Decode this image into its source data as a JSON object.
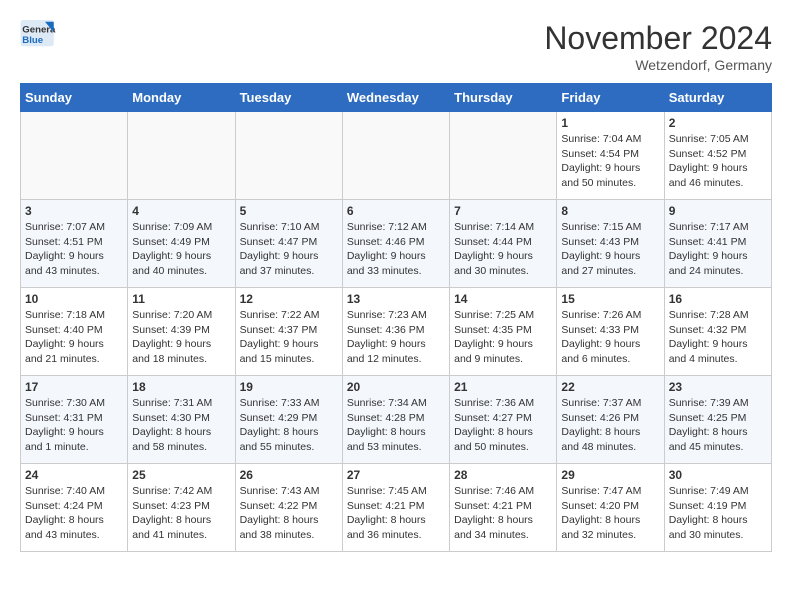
{
  "header": {
    "logo_line1": "General",
    "logo_line2": "Blue",
    "month_title": "November 2024",
    "location": "Wetzendorf, Germany"
  },
  "calendar": {
    "days_of_week": [
      "Sunday",
      "Monday",
      "Tuesday",
      "Wednesday",
      "Thursday",
      "Friday",
      "Saturday"
    ],
    "weeks": [
      [
        {
          "day": "",
          "info": ""
        },
        {
          "day": "",
          "info": ""
        },
        {
          "day": "",
          "info": ""
        },
        {
          "day": "",
          "info": ""
        },
        {
          "day": "",
          "info": ""
        },
        {
          "day": "1",
          "info": "Sunrise: 7:04 AM\nSunset: 4:54 PM\nDaylight: 9 hours\nand 50 minutes."
        },
        {
          "day": "2",
          "info": "Sunrise: 7:05 AM\nSunset: 4:52 PM\nDaylight: 9 hours\nand 46 minutes."
        }
      ],
      [
        {
          "day": "3",
          "info": "Sunrise: 7:07 AM\nSunset: 4:51 PM\nDaylight: 9 hours\nand 43 minutes."
        },
        {
          "day": "4",
          "info": "Sunrise: 7:09 AM\nSunset: 4:49 PM\nDaylight: 9 hours\nand 40 minutes."
        },
        {
          "day": "5",
          "info": "Sunrise: 7:10 AM\nSunset: 4:47 PM\nDaylight: 9 hours\nand 37 minutes."
        },
        {
          "day": "6",
          "info": "Sunrise: 7:12 AM\nSunset: 4:46 PM\nDaylight: 9 hours\nand 33 minutes."
        },
        {
          "day": "7",
          "info": "Sunrise: 7:14 AM\nSunset: 4:44 PM\nDaylight: 9 hours\nand 30 minutes."
        },
        {
          "day": "8",
          "info": "Sunrise: 7:15 AM\nSunset: 4:43 PM\nDaylight: 9 hours\nand 27 minutes."
        },
        {
          "day": "9",
          "info": "Sunrise: 7:17 AM\nSunset: 4:41 PM\nDaylight: 9 hours\nand 24 minutes."
        }
      ],
      [
        {
          "day": "10",
          "info": "Sunrise: 7:18 AM\nSunset: 4:40 PM\nDaylight: 9 hours\nand 21 minutes."
        },
        {
          "day": "11",
          "info": "Sunrise: 7:20 AM\nSunset: 4:39 PM\nDaylight: 9 hours\nand 18 minutes."
        },
        {
          "day": "12",
          "info": "Sunrise: 7:22 AM\nSunset: 4:37 PM\nDaylight: 9 hours\nand 15 minutes."
        },
        {
          "day": "13",
          "info": "Sunrise: 7:23 AM\nSunset: 4:36 PM\nDaylight: 9 hours\nand 12 minutes."
        },
        {
          "day": "14",
          "info": "Sunrise: 7:25 AM\nSunset: 4:35 PM\nDaylight: 9 hours\nand 9 minutes."
        },
        {
          "day": "15",
          "info": "Sunrise: 7:26 AM\nSunset: 4:33 PM\nDaylight: 9 hours\nand 6 minutes."
        },
        {
          "day": "16",
          "info": "Sunrise: 7:28 AM\nSunset: 4:32 PM\nDaylight: 9 hours\nand 4 minutes."
        }
      ],
      [
        {
          "day": "17",
          "info": "Sunrise: 7:30 AM\nSunset: 4:31 PM\nDaylight: 9 hours\nand 1 minute."
        },
        {
          "day": "18",
          "info": "Sunrise: 7:31 AM\nSunset: 4:30 PM\nDaylight: 8 hours\nand 58 minutes."
        },
        {
          "day": "19",
          "info": "Sunrise: 7:33 AM\nSunset: 4:29 PM\nDaylight: 8 hours\nand 55 minutes."
        },
        {
          "day": "20",
          "info": "Sunrise: 7:34 AM\nSunset: 4:28 PM\nDaylight: 8 hours\nand 53 minutes."
        },
        {
          "day": "21",
          "info": "Sunrise: 7:36 AM\nSunset: 4:27 PM\nDaylight: 8 hours\nand 50 minutes."
        },
        {
          "day": "22",
          "info": "Sunrise: 7:37 AM\nSunset: 4:26 PM\nDaylight: 8 hours\nand 48 minutes."
        },
        {
          "day": "23",
          "info": "Sunrise: 7:39 AM\nSunset: 4:25 PM\nDaylight: 8 hours\nand 45 minutes."
        }
      ],
      [
        {
          "day": "24",
          "info": "Sunrise: 7:40 AM\nSunset: 4:24 PM\nDaylight: 8 hours\nand 43 minutes."
        },
        {
          "day": "25",
          "info": "Sunrise: 7:42 AM\nSunset: 4:23 PM\nDaylight: 8 hours\nand 41 minutes."
        },
        {
          "day": "26",
          "info": "Sunrise: 7:43 AM\nSunset: 4:22 PM\nDaylight: 8 hours\nand 38 minutes."
        },
        {
          "day": "27",
          "info": "Sunrise: 7:45 AM\nSunset: 4:21 PM\nDaylight: 8 hours\nand 36 minutes."
        },
        {
          "day": "28",
          "info": "Sunrise: 7:46 AM\nSunset: 4:21 PM\nDaylight: 8 hours\nand 34 minutes."
        },
        {
          "day": "29",
          "info": "Sunrise: 7:47 AM\nSunset: 4:20 PM\nDaylight: 8 hours\nand 32 minutes."
        },
        {
          "day": "30",
          "info": "Sunrise: 7:49 AM\nSunset: 4:19 PM\nDaylight: 8 hours\nand 30 minutes."
        }
      ]
    ]
  }
}
